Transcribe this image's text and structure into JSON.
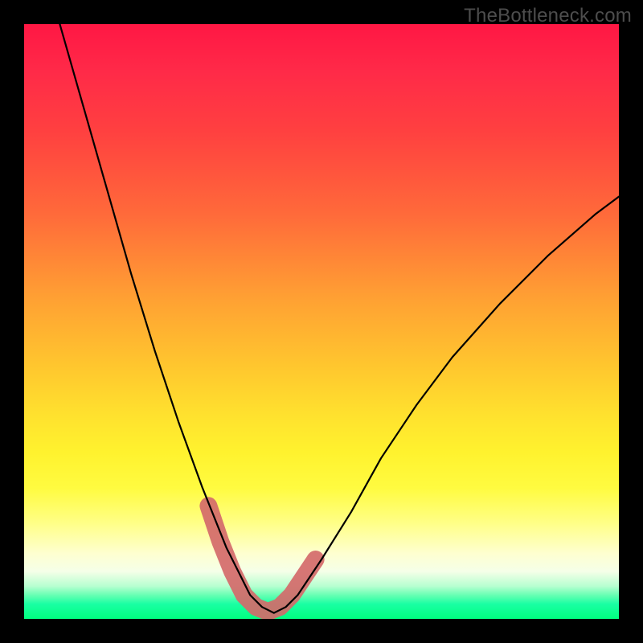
{
  "watermark": {
    "text": "TheBottleneck.com"
  },
  "colors": {
    "background": "#000000",
    "curve": "#000000",
    "band": "#d46a6a",
    "gradient_stops": [
      "#ff1744",
      "#ff2a48",
      "#ff4040",
      "#ff6a3a",
      "#ffa033",
      "#ffc82e",
      "#ffe22e",
      "#fff22e",
      "#fffb40",
      "#ffff88",
      "#feffd0",
      "#f5ffe8",
      "#b7ffd0",
      "#67ffb3",
      "#1affa3",
      "#00ff80"
    ]
  },
  "chart_data": {
    "type": "line",
    "title": "",
    "xlabel": "",
    "ylabel": "",
    "xlim": [
      0,
      100
    ],
    "ylim": [
      0,
      100
    ],
    "grid": false,
    "legend": false,
    "series": [
      {
        "name": "bottleneck-curve",
        "x": [
          6,
          10,
          14,
          18,
          22,
          26,
          30,
          34,
          36,
          38,
          40,
          42,
          44,
          46,
          50,
          55,
          60,
          66,
          72,
          80,
          88,
          96,
          100
        ],
        "y": [
          100,
          86,
          72,
          58,
          45,
          33,
          22,
          12,
          8,
          4,
          2,
          1,
          2,
          4,
          10,
          18,
          27,
          36,
          44,
          53,
          61,
          68,
          71
        ]
      }
    ],
    "highlight_band": {
      "description": "Highlighted region near the curve minimum",
      "path": [
        {
          "x": 31,
          "y": 19
        },
        {
          "x": 33,
          "y": 13
        },
        {
          "x": 35,
          "y": 8
        },
        {
          "x": 37,
          "y": 4
        },
        {
          "x": 39,
          "y": 2
        },
        {
          "x": 41,
          "y": 1.2
        },
        {
          "x": 43,
          "y": 2
        },
        {
          "x": 45,
          "y": 4
        },
        {
          "x": 47,
          "y": 7
        },
        {
          "x": 49,
          "y": 10
        }
      ]
    }
  }
}
